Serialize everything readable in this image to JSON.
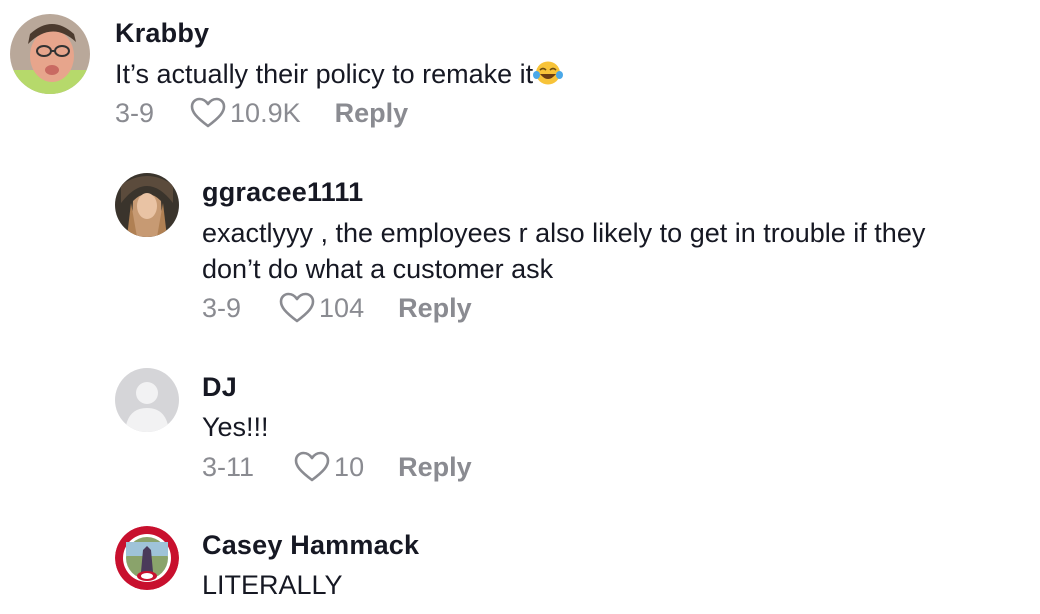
{
  "comments": [
    {
      "username": "Krabby",
      "text": "It’s actually their policy to remake it",
      "emoji": "tears-of-joy-emoji",
      "date": "3-9",
      "likes": "10.9K",
      "reply_label": "Reply",
      "avatar": "user-photo-avatar"
    },
    {
      "username": "ggracee1111",
      "text_line1": "exactlyyy , the employees r also likely to get in trouble if they",
      "text_line2": "don’t do what a customer ask",
      "date": "3-9",
      "likes": "104",
      "reply_label": "Reply",
      "avatar": "user-photo-avatar"
    },
    {
      "username": "DJ",
      "text": "Yes!!!",
      "date": "3-11",
      "likes": "10",
      "reply_label": "Reply",
      "avatar": "default-avatar"
    },
    {
      "username": "Casey Hammack",
      "text": "LITERALLY",
      "avatar": "team-logo-avatar"
    }
  ],
  "icons": {
    "like": "heart-outline-icon"
  },
  "colors": {
    "text": "#161823",
    "secondary": "#8a8b91",
    "background": "#ffffff"
  }
}
